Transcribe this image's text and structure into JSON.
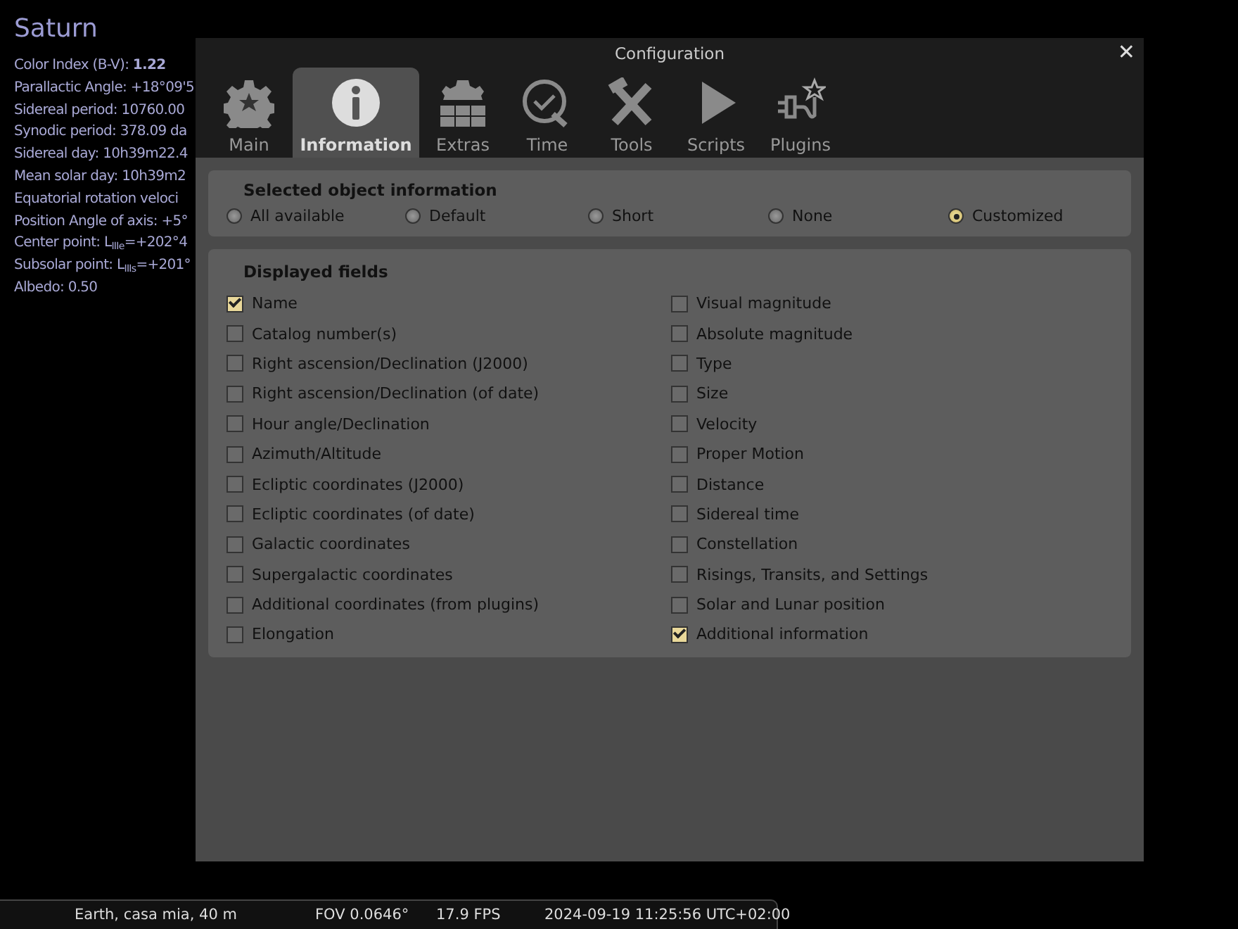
{
  "object_info": {
    "title": "Saturn",
    "lines": [
      "Color Index (B-V): **1.22**",
      "Parallactic Angle: +18°09'5",
      "Sidereal period: 10760.00",
      "Synodic period: 378.09 da",
      "Sidereal day: 10h39m22.4",
      "Mean solar day: 10h39m2",
      "Equatorial rotation veloci",
      "Position Angle of axis: +5°",
      "Center point: L$_{IIIe}$=+202°4",
      "Subsolar point: L$_{IIIs}$=+201°",
      "Albedo: 0.50"
    ]
  },
  "dialog": {
    "title": "Configuration",
    "close": "✕",
    "tabs": [
      {
        "label": "Main",
        "selected": false
      },
      {
        "label": "Information",
        "selected": true
      },
      {
        "label": "Extras",
        "selected": false
      },
      {
        "label": "Time",
        "selected": false
      },
      {
        "label": "Tools",
        "selected": false
      },
      {
        "label": "Scripts",
        "selected": false
      },
      {
        "label": "Plugins",
        "selected": false
      }
    ],
    "selected_object_information": {
      "title": "Selected object information",
      "options": [
        {
          "label": "All available",
          "selected": false
        },
        {
          "label": "Default",
          "selected": false
        },
        {
          "label": "Short",
          "selected": false
        },
        {
          "label": "None",
          "selected": false
        },
        {
          "label": "Customized",
          "selected": true
        }
      ]
    },
    "displayed_fields": {
      "title": "Displayed fields",
      "columns": [
        [
          {
            "label": "Name",
            "checked": true
          },
          {
            "label": "Catalog number(s)",
            "checked": false
          },
          {
            "label": "Right ascension/Declination (J2000)",
            "checked": false
          },
          {
            "label": "Right ascension/Declination (of date)",
            "checked": false
          },
          {
            "label": "Hour angle/Declination",
            "checked": false
          },
          {
            "label": "Azimuth/Altitude",
            "checked": false
          },
          {
            "label": "Ecliptic coordinates (J2000)",
            "checked": false
          },
          {
            "label": "Ecliptic coordinates (of date)",
            "checked": false
          },
          {
            "label": "Galactic coordinates",
            "checked": false
          },
          {
            "label": "Supergalactic coordinates",
            "checked": false
          },
          {
            "label": "Additional coordinates (from plugins)",
            "checked": false
          },
          {
            "label": "Elongation",
            "checked": false
          }
        ],
        [
          {
            "label": "Visual magnitude",
            "checked": false
          },
          {
            "label": "Absolute magnitude",
            "checked": false
          },
          {
            "label": "Type",
            "checked": false
          },
          {
            "label": "Size",
            "checked": false
          },
          {
            "label": "Velocity",
            "checked": false
          },
          {
            "label": "Proper Motion",
            "checked": false
          },
          {
            "label": "Distance",
            "checked": false
          },
          {
            "label": "Sidereal time",
            "checked": false
          },
          {
            "label": "Constellation",
            "checked": false
          },
          {
            "label": "Risings, Transits, and Settings",
            "checked": false
          },
          {
            "label": "Solar and Lunar position",
            "checked": false
          },
          {
            "label": "Additional information",
            "checked": true
          }
        ]
      ]
    }
  },
  "status_bar": {
    "location": "Earth, casa mia, 40 m",
    "fov": "FOV 0.0646°",
    "fps": "17.9 FPS",
    "datetime": "2024-09-19 11:25:56 UTC+02:00"
  }
}
